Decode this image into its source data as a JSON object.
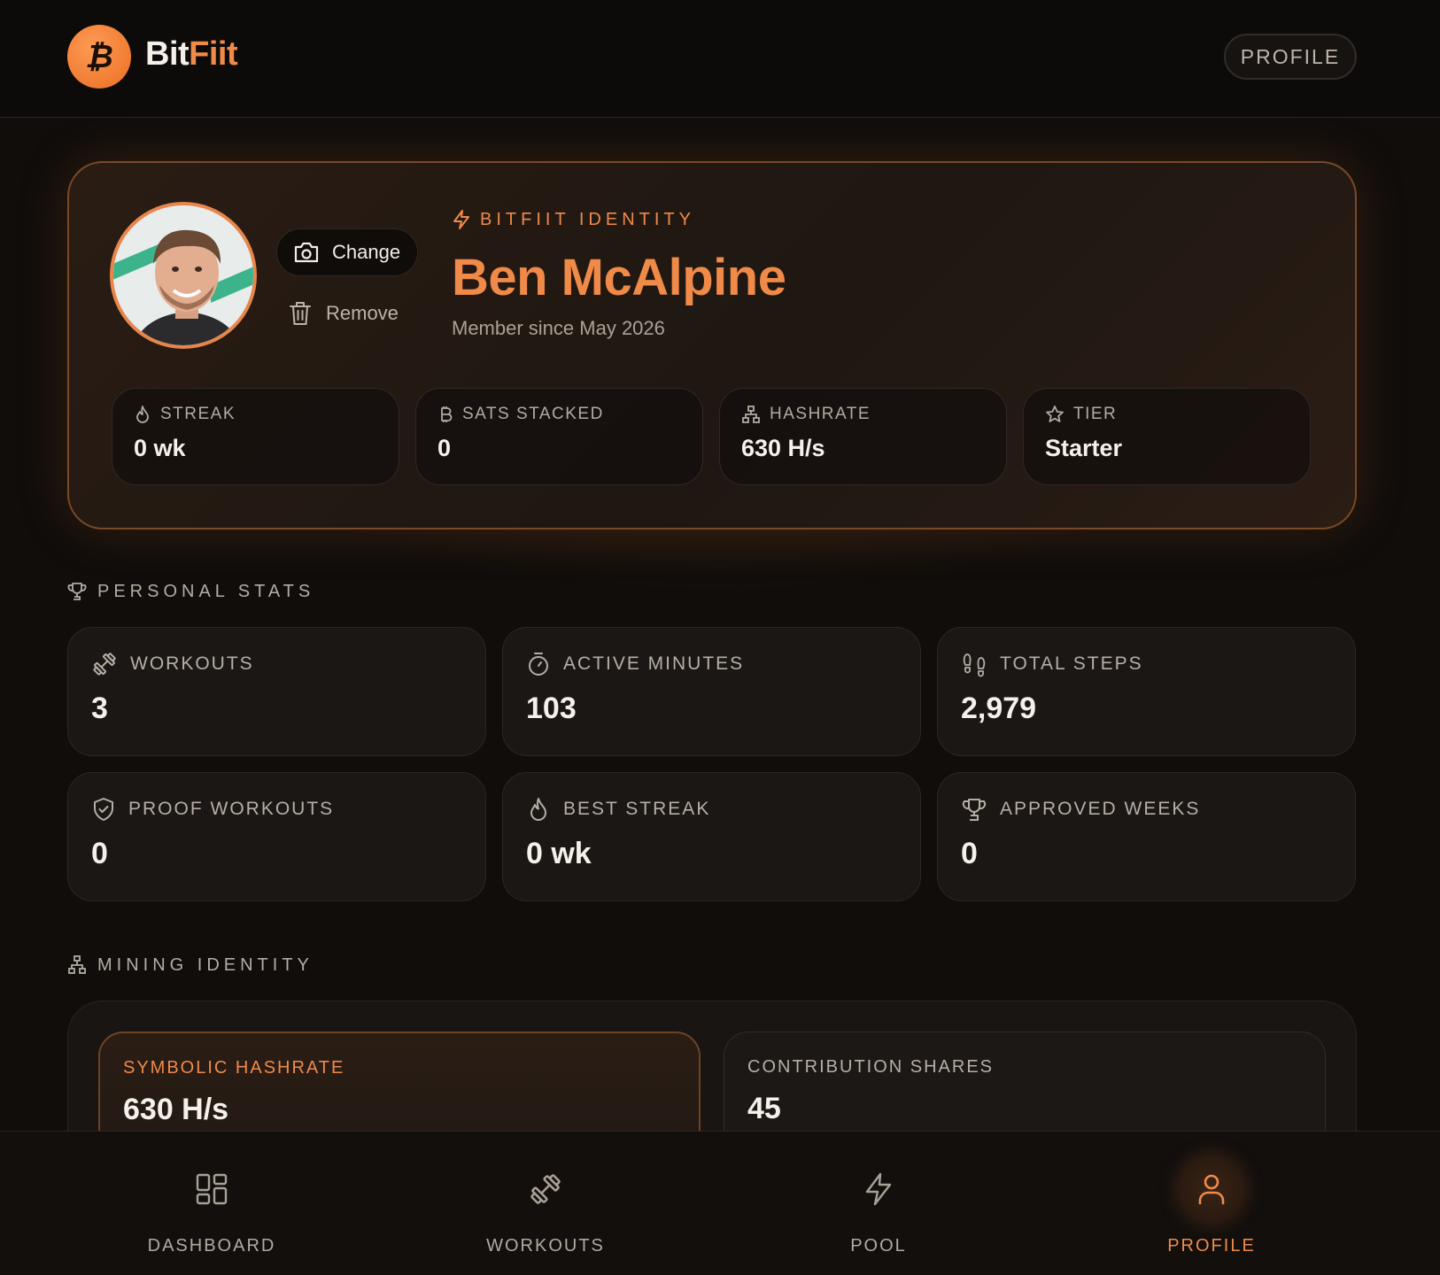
{
  "header": {
    "brand_part1": "Bit",
    "brand_part2": "Fiit",
    "logo_symbol": "₿",
    "profile_button": "PROFILE"
  },
  "identity": {
    "change_label": "Change",
    "remove_label": "Remove",
    "eyebrow": "BITFIIT IDENTITY",
    "name": "Ben McAlpine",
    "member_since": "Member since May 2026",
    "stats": [
      {
        "label": "STREAK",
        "value": "0 wk",
        "icon": "flame-icon"
      },
      {
        "label": "SATS STACKED",
        "value": "0",
        "icon": "bitcoin-icon"
      },
      {
        "label": "HASHRATE",
        "value": "630 H/s",
        "icon": "network-icon"
      },
      {
        "label": "TIER",
        "value": "Starter",
        "icon": "star-icon"
      }
    ]
  },
  "personal_stats": {
    "title": "PERSONAL STATS",
    "cards": [
      {
        "label": "WORKOUTS",
        "value": "3",
        "icon": "dumbbell-icon"
      },
      {
        "label": "ACTIVE MINUTES",
        "value": "103",
        "icon": "timer-icon"
      },
      {
        "label": "TOTAL STEPS",
        "value": "2,979",
        "icon": "footprints-icon"
      },
      {
        "label": "PROOF WORKOUTS",
        "value": "0",
        "icon": "shield-check-icon"
      },
      {
        "label": "BEST STREAK",
        "value": "0 wk",
        "icon": "flame-icon"
      },
      {
        "label": "APPROVED WEEKS",
        "value": "0",
        "icon": "trophy-icon"
      }
    ]
  },
  "mining_identity": {
    "title": "MINING IDENTITY",
    "cards": [
      {
        "label": "SYMBOLIC HASHRATE",
        "value": "630 H/s"
      },
      {
        "label": "CONTRIBUTION SHARES",
        "value": "45"
      }
    ]
  },
  "nav": [
    {
      "label": "DASHBOARD",
      "icon": "dashboard-icon"
    },
    {
      "label": "WORKOUTS",
      "icon": "dumbbell-icon"
    },
    {
      "label": "POOL",
      "icon": "lightning-icon"
    },
    {
      "label": "PROFILE",
      "icon": "user-icon",
      "active": true
    }
  ],
  "colors": {
    "accent": "#f08a48",
    "background": "#100d0b",
    "card": "#1b1715"
  }
}
